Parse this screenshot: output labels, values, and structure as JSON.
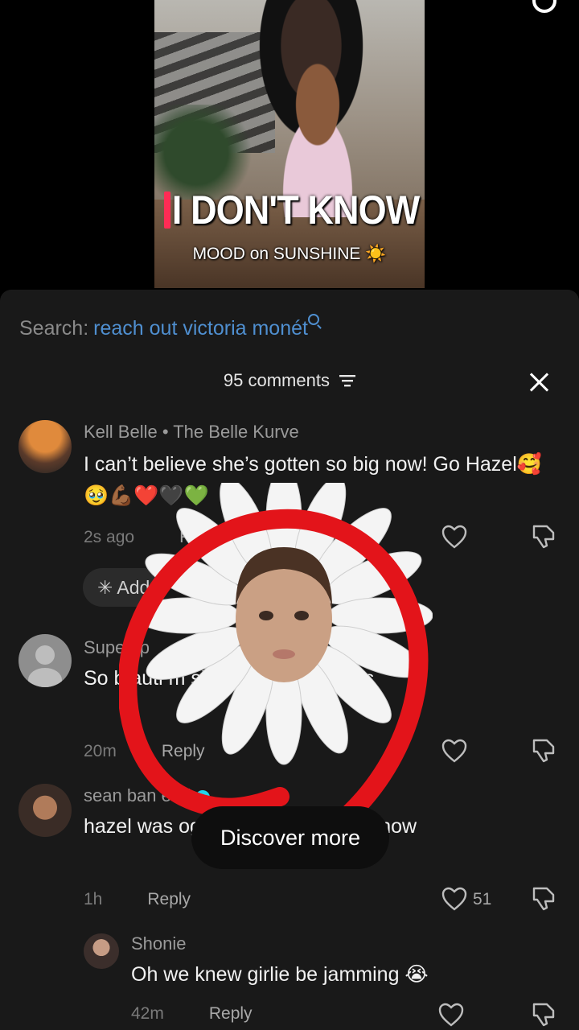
{
  "video": {
    "caption_main": "I DON'T KNOW",
    "caption_sub": "MOOD on SUNSHINE ☀️"
  },
  "search": {
    "label": "Search:",
    "query": "reach out victoria monét"
  },
  "comments_header": {
    "count_text": "95 comments"
  },
  "comments": [
    {
      "name": "Kell Belle • The Belle Kurve",
      "text": "I can’t believe she’s gotten so big now! Go Hazel🥰🥹💪🏾❤️🖤💚",
      "time": "2s ago",
      "reply": "Reply"
    },
    {
      "name": "Supe   op",
      "text": "So b   auti              m she may be i   movies",
      "time": "20m",
      "reply": "Reply"
    },
    {
      "name": "sean ban   ead",
      "text": "hazel was             ographer if yall didn’t know",
      "time": "1h",
      "reply": "Reply",
      "likes": "51"
    },
    {
      "name": "Shonie",
      "text": "Oh we knew girlie be jamming 😭",
      "time": "42m",
      "reply": "Reply"
    }
  ],
  "add_chip": "Add",
  "discover_label": "Discover more",
  "colors": {
    "accent": "#fe2c55",
    "link": "#4f8fd0",
    "verified": "#20d5ec",
    "sheet_bg": "#191919"
  },
  "icons": [
    "search-icon",
    "sort-icon",
    "close-icon",
    "heart-icon",
    "dislike-icon",
    "verified-icon",
    "sparkle-icon"
  ]
}
